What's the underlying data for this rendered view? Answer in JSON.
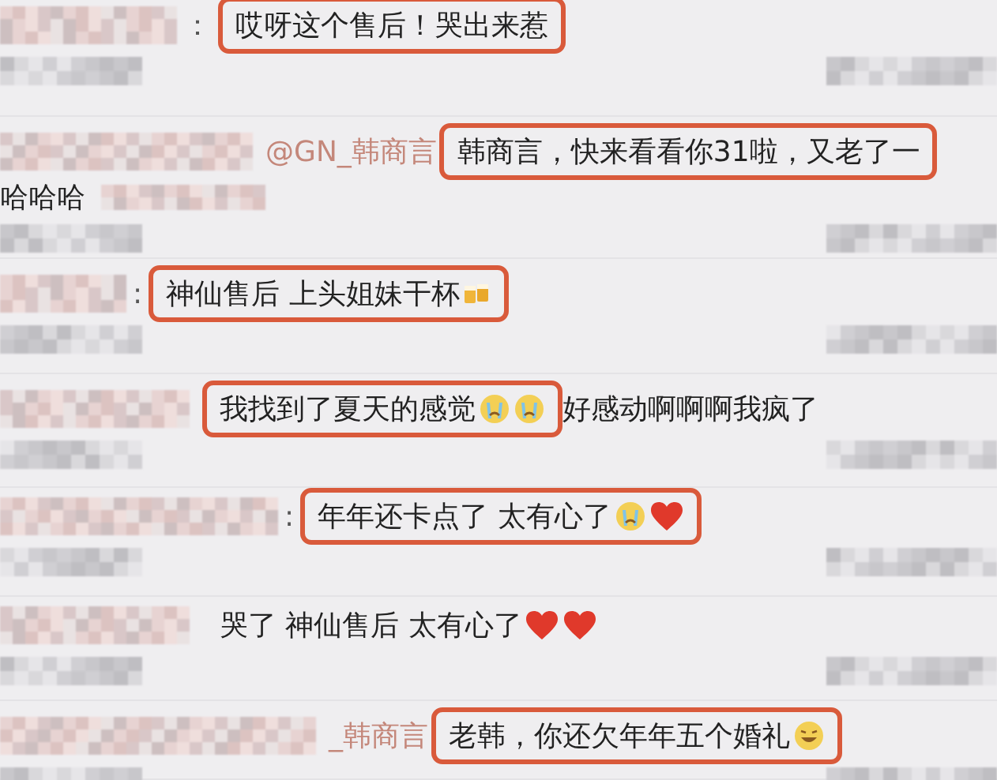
{
  "comments": [
    {
      "separator": "：",
      "text": "哎呀这个售后！哭出来惹",
      "highlighted": true
    },
    {
      "mention": "@GN_韩商言",
      "text": "韩商言，快来看看你31啦，又老了一",
      "highlighted": true,
      "continuation": "哈哈哈"
    },
    {
      "separator": ":",
      "text": "神仙售后 上头姐妹干杯",
      "highlighted": true,
      "emojis": [
        {
          "kind": "beer"
        }
      ]
    },
    {
      "text": "我找到了夏天的感觉",
      "highlighted": true,
      "emojis": [
        {
          "kind": "cry"
        },
        {
          "kind": "cry"
        }
      ],
      "after": "好感动啊啊啊我疯了"
    },
    {
      "separator": ":",
      "text": "年年还卡点了  太有心了",
      "highlighted": true,
      "emojis": [
        {
          "kind": "cry"
        },
        {
          "kind": "heart"
        }
      ]
    },
    {
      "text": "哭了 神仙售后 太有心了",
      "highlighted": false,
      "emojis": [
        {
          "kind": "heart"
        },
        {
          "kind": "heart"
        }
      ]
    },
    {
      "mention": "_韩商言",
      "text": "老韩，你还欠年年五个婚礼",
      "highlighted": true,
      "emojis": [
        {
          "kind": "laugh"
        }
      ]
    }
  ]
}
